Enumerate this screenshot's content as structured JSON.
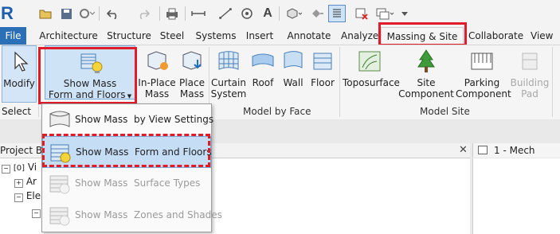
{
  "quick_access": {
    "app_icon": "revit-R-icon",
    "icons": [
      "open-icon",
      "save-icon",
      "sync-icon",
      "undo-icon",
      "redo-icon",
      "print-icon",
      "measure-icon",
      "dimension-icon",
      "tag-icon",
      "text-icon",
      "3d-view-icon",
      "section-icon",
      "thin-lines-icon",
      "close-hidden-icon",
      "switch-windows-icon",
      "customize-icon"
    ]
  },
  "tabs": {
    "file": "File",
    "architecture": "Architecture",
    "structure": "Structure",
    "steel": "Steel",
    "systems": "Systems",
    "insert": "Insert",
    "annotate": "Annotate",
    "analyze": "Analyze",
    "massing_site": "Massing & Site",
    "collaborate": "Collaborate",
    "view": "View"
  },
  "ribbon": {
    "modify": "Modify",
    "select": "Select",
    "show_mass_line1": "Show Mass",
    "show_mass_line2": "Form and Floors",
    "inplace_line1": "In-Place",
    "inplace_line2": "Mass",
    "place_line1": "Place",
    "place_line2": "Mass",
    "curtain_line1": "Curtain",
    "curtain_line2": "System",
    "roof": "Roof",
    "wall": "Wall",
    "floor": "Floor",
    "model_by_face": "Model by Face",
    "toposurface": "Toposurface",
    "site_line1": "Site",
    "site_line2": "Component",
    "parking_line1": "Parking",
    "parking_line2": "Component",
    "pad_line1": "Building",
    "pad_line2": "Pad",
    "model_site": "Model Site"
  },
  "dropdown": {
    "items": [
      {
        "label": "Show Mass  by View Settings",
        "enabled": true
      },
      {
        "label": "Show Mass  Form and Floors",
        "enabled": true
      },
      {
        "label": "Show Mass  Surface Types",
        "enabled": false
      },
      {
        "label": "Show Mass  Zones and Shades",
        "enabled": false
      }
    ]
  },
  "project_browser": {
    "title": "Project Br",
    "tree": [
      "Vi",
      "Ar",
      "Ele"
    ]
  },
  "view_tab": {
    "title": "1 - Mech"
  },
  "colors": {
    "file_tab": "#2b6fb6",
    "highlight_box": "#e01c2a",
    "selected_bg": "#c5ddf5"
  }
}
